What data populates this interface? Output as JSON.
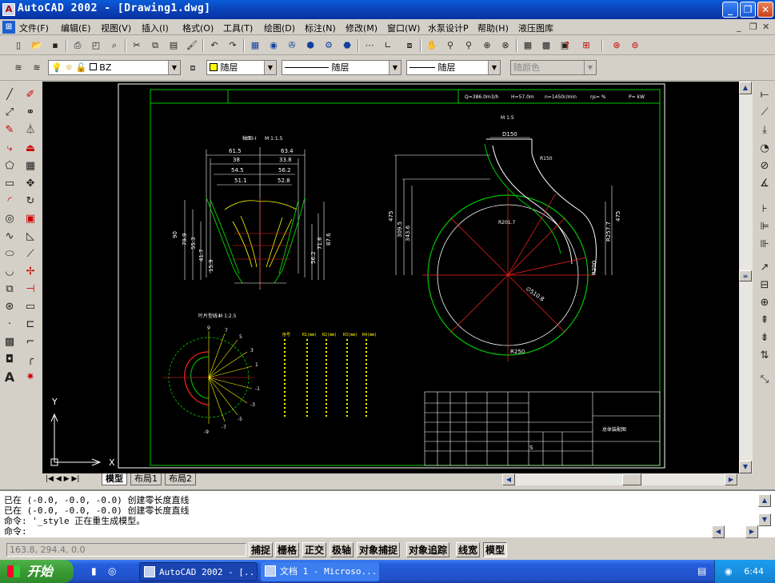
{
  "window": {
    "title": "AutoCAD 2002 - [Drawing1.dwg]",
    "app_icon": "A",
    "min_glyph": "_",
    "max_glyph": "❐",
    "close_glyph": "✕"
  },
  "menu": {
    "items": [
      "文件(F)",
      "编辑(E)",
      "视图(V)",
      "插入(I)",
      "格式(O)",
      "工具(T)",
      "绘图(D)",
      "标注(N)",
      "修改(M)",
      "窗口(W)",
      "水泵设计P",
      "帮助(H)",
      "液压图库"
    ],
    "mdi_min": "_",
    "mdi_restore": "❐",
    "mdi_close": "✕"
  },
  "layers": {
    "current_layer": "BZ",
    "color": "随层",
    "linetype": "随层",
    "lineweight": "随层",
    "plotstyle": "随颜色"
  },
  "tabs": {
    "nav_first": "|◀",
    "nav_prev": "◀",
    "nav_next": "▶",
    "nav_last": "▶|",
    "items": [
      "模型",
      "布局1",
      "布局2"
    ]
  },
  "command": {
    "lines": [
      "已在 (-0.0, -0.0, -0.0) 创建零长度直线",
      "已在 (-0.0, -0.0, -0.0) 创建零长度直线",
      "命令: '_style 正在重生成模型。"
    ],
    "prompt": "命令:"
  },
  "status": {
    "coords": "163.8, 294.4, 0.0",
    "toggles": [
      "捕捉",
      "栅格",
      "正交",
      "极轴",
      "对象捕捉",
      "对象追踪",
      "线宽",
      "模型"
    ]
  },
  "taskbar": {
    "start": "开始",
    "tasks": [
      "AutoCAD 2002 - [...",
      "文档 1 - Microso..."
    ],
    "clock": "6:44"
  },
  "drawing": {
    "header": {
      "q": "Q=386.0m3/h",
      "h": "H=57.0m",
      "n": "n=1450r/min",
      "ns": "ηs=  %",
      "p": "P=  kW"
    },
    "section_title": "轴面I-I",
    "section_scale": "M 1:1.5",
    "volute_scale": "M 1:5",
    "profile_title": "叶片型线 I",
    "profile_scale": "M 1:2.5",
    "dims_top": [
      "61.5",
      "63.4",
      "38",
      "33.8",
      "54.5",
      "56.2",
      "51.1",
      "52.8"
    ],
    "dims_left": [
      "90",
      "79.9",
      "55.3",
      "41.7",
      "15.9"
    ],
    "dims_right": [
      "87.6",
      "71.6",
      "56.2"
    ],
    "volute_dims": [
      "D150",
      "R150",
      "R201.7",
      "475",
      "309.5",
      "343.6",
      "475",
      "R257.7",
      "R200",
      "∅510.8",
      "R250"
    ],
    "radial_labels": [
      "9",
      "7",
      "5",
      "3",
      "1",
      "-1",
      "-3",
      "-5",
      "-7",
      "-9"
    ],
    "table_headers": [
      "序号",
      "R1(mm)",
      "R2(mm)",
      "R3(mm)",
      "R4(mm)"
    ],
    "title_block": "总体装配图",
    "title_block_mark": "S"
  },
  "colors": {
    "accent": "#0a5bd8",
    "cad_bg": "#000000",
    "green": "#00c800",
    "yellow": "#ffff00",
    "red": "#ff2020",
    "white": "#ffffff"
  }
}
